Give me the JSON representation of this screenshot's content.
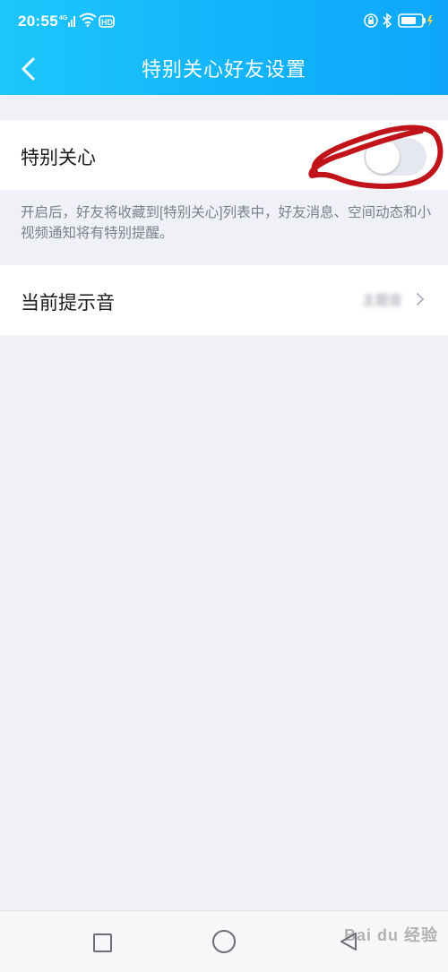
{
  "status_bar": {
    "time": "20:55",
    "network": "4G",
    "hd_label": "HD",
    "icons": [
      "signal-icon",
      "wifi-icon",
      "lock-icon",
      "bluetooth-icon",
      "battery-icon"
    ]
  },
  "nav": {
    "title": "特别关心好友设置",
    "back_icon": "chevron-left-icon"
  },
  "special_care": {
    "label": "特别关心",
    "toggle_on": false,
    "description": "开启后，好友将收藏到[特别关心]列表中，好友消息、空间动态和小视频通知将有特别提醒。"
  },
  "tone": {
    "label": "当前提示音",
    "value": "主题音"
  },
  "bottom_nav": {
    "icons": [
      "recent-apps-icon",
      "home-icon",
      "back-icon"
    ]
  },
  "watermark": {
    "text": "Bai du 经验"
  },
  "colors": {
    "header_start": "#1ec6fb",
    "header_end": "#0fa6fa",
    "annotation": "#c0141a",
    "background": "#eff1f6"
  }
}
